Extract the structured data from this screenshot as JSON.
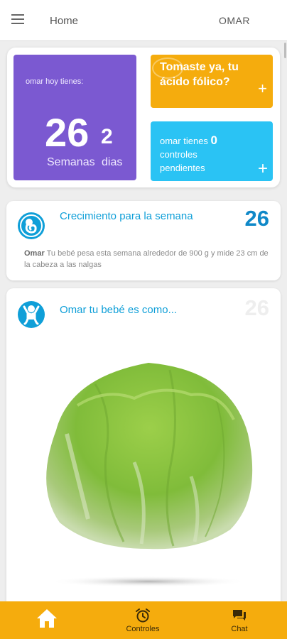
{
  "appbar": {
    "title": "Home",
    "user": "OMAR"
  },
  "summary": {
    "greeting": "omar hoy tienes:",
    "weeks": "26",
    "days": "2",
    "weeks_label": "Semanas",
    "days_label": "dias",
    "folic_text": "Tomaste ya, tu ácido fólico?",
    "controls_prefix": "omar tienes",
    "controls_count": "0",
    "controls_suffix": "controles pendientes",
    "plus": "+"
  },
  "growth": {
    "title": "Crecimiento para la semana",
    "week": "26",
    "name": "Omar",
    "description": "Tu bebé pesa esta semana alrededor de 900 g y mide 23 cm de la cabeza a las nalgas"
  },
  "comparison": {
    "title": "Omar tu bebé es como...",
    "week": "26"
  },
  "nav": {
    "controls": "Controles",
    "chat": "Chat"
  },
  "colors": {
    "purple": "#7b59d1",
    "orange": "#f5ac0d",
    "sky": "#2ac3f4",
    "blue": "#0f9fd8"
  },
  "icons": [
    "menu-icon",
    "plus-icon",
    "fetus-icon",
    "baby-icon",
    "home-icon",
    "alarm-clock-icon",
    "chat-icon"
  ]
}
